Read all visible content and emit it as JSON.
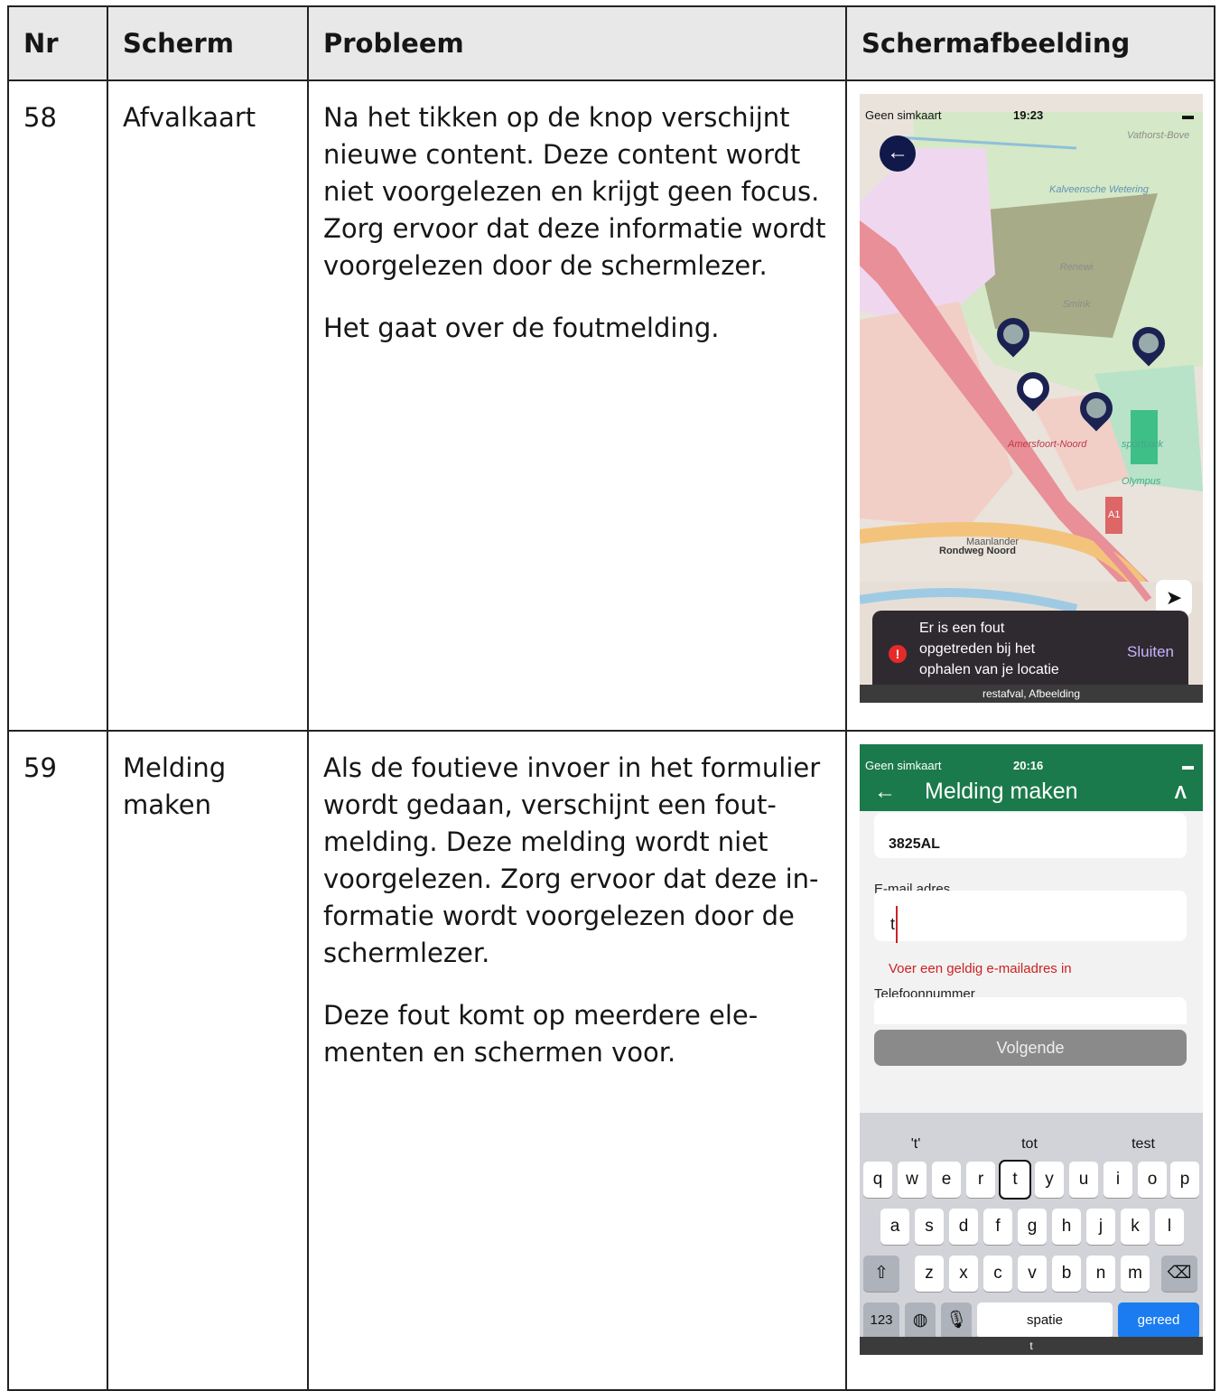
{
  "table": {
    "headers": [
      "Nr",
      "Scherm",
      "Probleem",
      "Schermafbeelding"
    ],
    "rows": [
      {
        "nr": "58",
        "scherm": "Afvalkaart",
        "probleem": [
          "Na het tikken op de knop verschijnt nieuwe content. Deze content wordt niet voorgelezen en krijgt geen focus. Zorg ervoor dat deze informatie wordt voorgelezen door de schermlezer.",
          "Het gaat over de foutmelding."
        ]
      },
      {
        "nr": "59",
        "scherm": "Melding maken",
        "probleem": [
          "Als de foutieve invoer in het formulier wordt gedaan, verschijnt een fout-melding. Deze melding wordt niet voorgelezen. Zorg ervoor dat deze in-formatie wordt voorgelezen door de schermlezer.",
          "Deze fout komt op meerdere ele-menten en schermen voor."
        ]
      }
    ]
  },
  "shot1": {
    "status": {
      "carrier": "Geen simkaart",
      "time": "19:23"
    },
    "map_labels": {
      "area": "Vathorst-Bove",
      "water": "Kalveensche Wetering",
      "site": "Renewi Smink",
      "station": "Amersfoort-Noord",
      "park": "sportpark Olympus",
      "road": "Rondweg Noord",
      "district": "Maanlander",
      "highway": "A1"
    },
    "toast": {
      "message": "Er is een fout opgetreden bij het ophalen van je locatie",
      "action": "Sluiten"
    },
    "caption": "restafval, Afbeelding"
  },
  "shot2": {
    "status": {
      "carrier": "Geen simkaart",
      "time": "20:16"
    },
    "title": "Melding maken",
    "postcode_value": "3825AL",
    "email_label": "E-mail adres",
    "email_value": "t",
    "email_error": "Voer een geldig e-mailadres in",
    "phone_label": "Telefoonnummer",
    "next_button": "Volgende",
    "suggestions": [
      "'t'",
      "tot",
      "test"
    ],
    "keys_row1": [
      "q",
      "w",
      "e",
      "r",
      "t",
      "y",
      "u",
      "i",
      "o",
      "p"
    ],
    "keys_row2": [
      "a",
      "s",
      "d",
      "f",
      "g",
      "h",
      "j",
      "k",
      "l"
    ],
    "keys_row3": [
      "z",
      "x",
      "c",
      "v",
      "b",
      "n",
      "m"
    ],
    "key_numbers": "123",
    "key_space": "spatie",
    "key_done": "gereed",
    "caption": "t"
  },
  "colors": {
    "app_green": "#1b7a4b",
    "error_red": "#c22",
    "nav_dark": "#11184a",
    "keyboard_blue": "#1a7cf0"
  }
}
